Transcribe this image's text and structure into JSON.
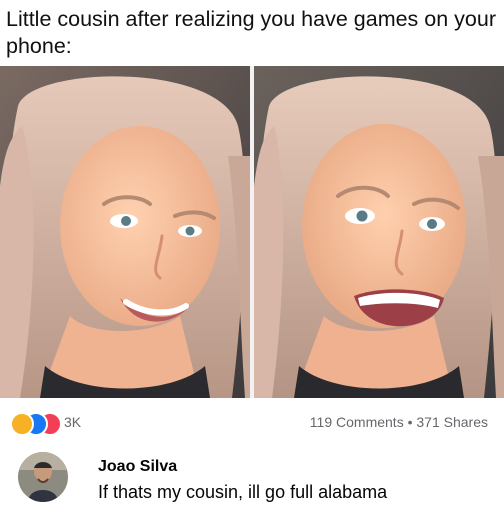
{
  "caption": "Little cousin after realizing you have games on your phone:",
  "photos": [
    {
      "name": "neutral-smile-photo"
    },
    {
      "name": "excited-smile-photo"
    }
  ],
  "reactions": {
    "icons": [
      "haha-reaction-icon",
      "like-reaction-icon",
      "love-reaction-icon"
    ],
    "count": "3K"
  },
  "stats": {
    "comments": "119 Comments",
    "separator": "•",
    "shares": "371 Shares"
  },
  "comment": {
    "author": "Joao Silva",
    "text": "If thats my cousin, ill go full alabama"
  },
  "colors": {
    "meta_text": "#65676b",
    "like_blue": "#1877f2",
    "love_red": "#f33e58",
    "haha_yellow": "#f7b125"
  }
}
